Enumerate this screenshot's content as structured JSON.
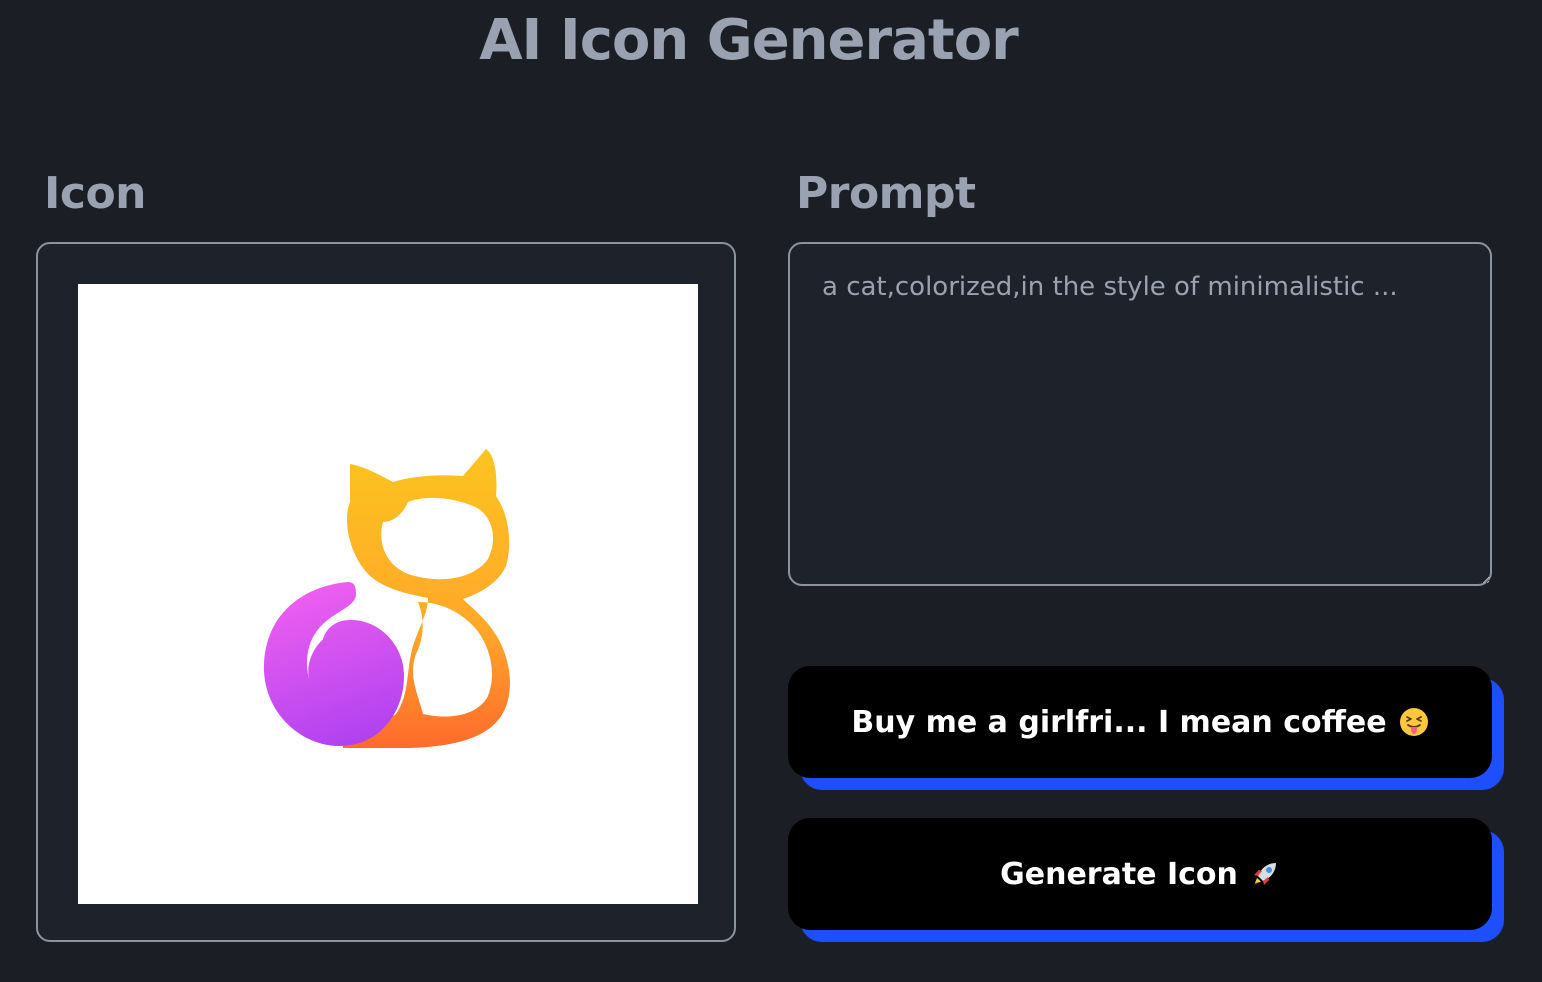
{
  "header": {
    "title": "AI Icon Generator"
  },
  "icon_panel": {
    "label": "Icon",
    "image_icon": "cat-icon",
    "image_colors": {
      "body_top": "#fcc41f",
      "body_bottom": "#ff6a2b",
      "tail_top": "#f060f0",
      "tail_bottom": "#b042f0"
    }
  },
  "prompt_panel": {
    "label": "Prompt",
    "placeholder": "a cat,colorized,in the style of minimalistic ...",
    "value": ""
  },
  "buttons": {
    "coffee_label": "Buy me a girlfri... I mean coffee",
    "coffee_icon": "tongue-out-emoji-icon",
    "generate_label": "Generate Icon",
    "generate_icon": "rocket-icon"
  },
  "colors": {
    "background": "#1b1e25",
    "panel": "#1e222a",
    "text_muted": "#9aa2b1",
    "button_bg": "#000000",
    "button_shadow": "#1e4fff"
  }
}
